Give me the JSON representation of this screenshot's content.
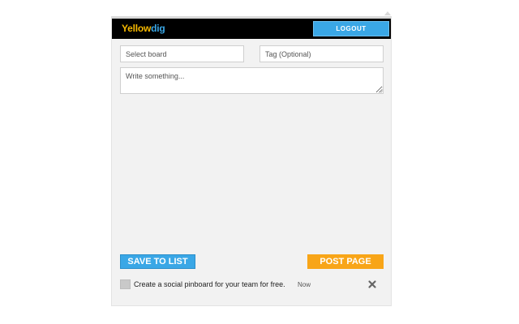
{
  "header": {
    "logo_part1": "Yellow",
    "logo_part2": "dig",
    "logout_label": "LOGOUT"
  },
  "form": {
    "board_placeholder": "Select board",
    "tag_placeholder": "Tag (Optional)",
    "write_placeholder": "Write something..."
  },
  "actions": {
    "save_label": "SAVE TO LIST",
    "post_label": "POST PAGE"
  },
  "notice": {
    "text": "Create a social pinboard for your team for free.",
    "time": "Now",
    "close_icon": "close-x-icon"
  },
  "colors": {
    "header_bg": "#000000",
    "logo_yellow": "#f5b800",
    "logo_blue": "#3aa7e6",
    "primary_blue": "#3aa7e6",
    "accent_orange": "#f8a518",
    "panel_bg": "#f2f2f2"
  }
}
